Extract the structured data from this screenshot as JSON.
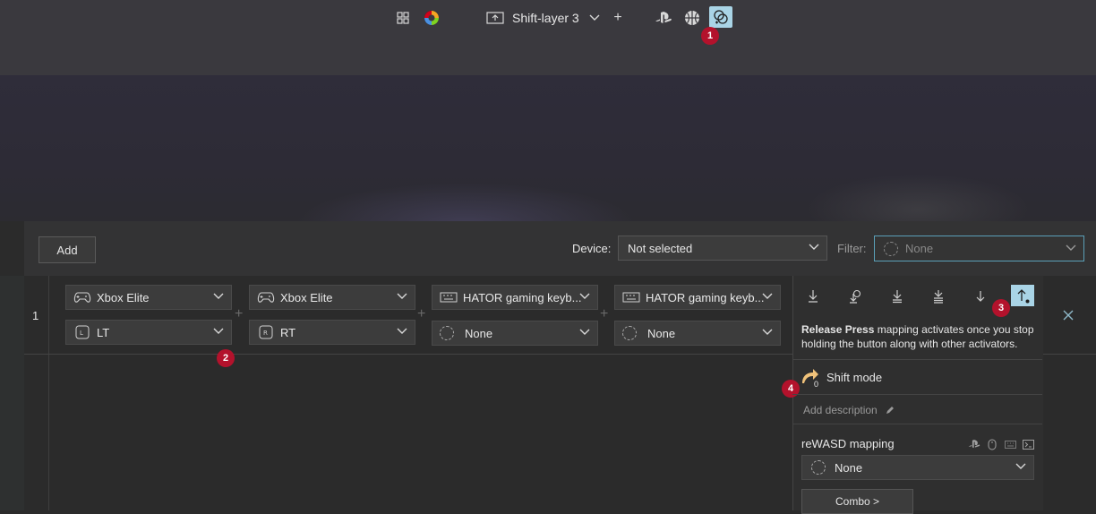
{
  "topbar": {
    "layer_name": "Shift-layer 3",
    "icons": [
      "grid-icon",
      "color-wheel-icon",
      "layer-add-icon",
      "chevron-down-icon",
      "plus-icon",
      "playstation-icon",
      "basketball-icon",
      "shift-mode-icon"
    ]
  },
  "badges": {
    "b1": "1",
    "b2": "2",
    "b3": "3",
    "b4": "4"
  },
  "toolbar": {
    "add_label": "Add",
    "device_label": "Device:",
    "device_value": "Not selected",
    "filter_label": "Filter:",
    "filter_value": "None"
  },
  "row": {
    "number": "1",
    "devices": [
      "Xbox Elite",
      "Xbox Elite",
      "HATOR gaming keyb...",
      "HATOR gaming keyb..."
    ],
    "buttons": [
      "LT",
      "RT",
      "None",
      "None"
    ]
  },
  "panel": {
    "description_bold": "Release Press",
    "description_rest": " mapping activates once you stop holding the button along with other activators.",
    "shift_mode_label": "Shift mode",
    "shift_sub": "0",
    "add_description": "Add description",
    "rewasd_mapping_label": "reWASD mapping",
    "mapping_value": "None",
    "combo_label": "Combo >"
  },
  "colors": {
    "accent": "#a9d4e6",
    "badge": "#b3122c",
    "background": "#2b2b2b"
  }
}
